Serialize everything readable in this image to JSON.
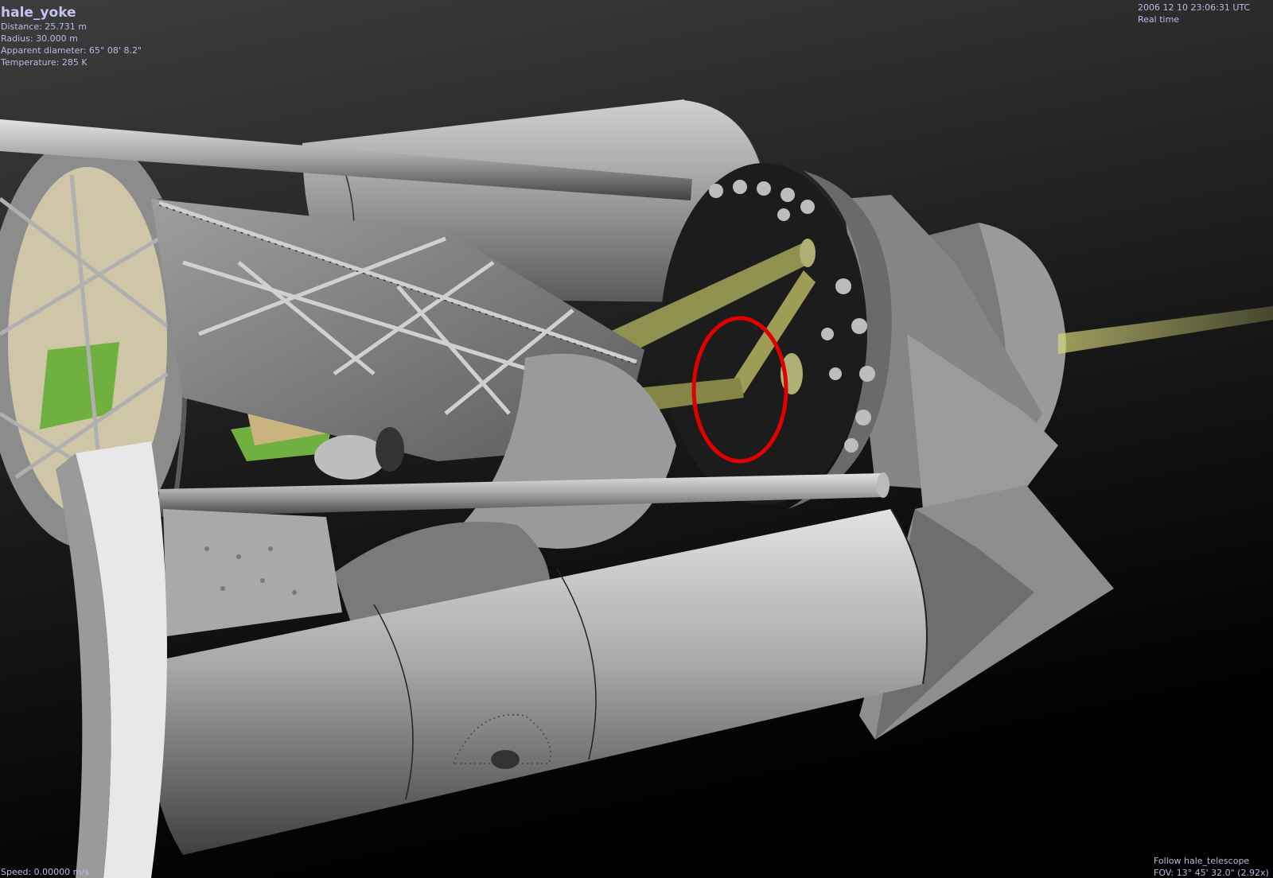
{
  "overlay": {
    "object": {
      "name": "hale_yoke",
      "distance": "Distance: 25.731 m",
      "radius": "Radius: 30.000 m",
      "apparent_diameter": "Apparent diameter: 65° 08' 8.2\"",
      "temperature": "Temperature: 285 K"
    },
    "clock": {
      "datetime": "2006 12 10 23:06:31 UTC",
      "time_mode": "Real time"
    },
    "speed": "Speed: 0.00000 m/s",
    "tracking": {
      "follow": "Follow hale_telescope",
      "fov": "FOV: 13° 45' 32.0\" (2.92x)"
    }
  },
  "annotation": {
    "type": "circle-marker",
    "color": "#e00000"
  },
  "scene_colors": {
    "background_top": "#3a3a3a",
    "background_bottom": "#000000",
    "metal_light": "#c8c8c8",
    "metal_mid": "#8a8a8a",
    "metal_dark": "#4a4a4a",
    "light_beam": "#d8d870",
    "green_panel": "#6fb040",
    "tan_panel": "#d2b98a"
  }
}
